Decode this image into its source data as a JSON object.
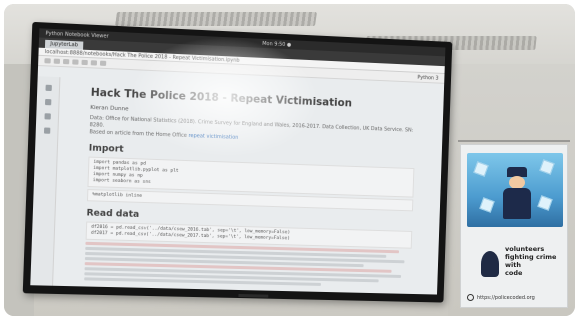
{
  "photo": {
    "description_tag": "photo of a wall-mounted TV showing a Jupyter notebook, with a poster at right"
  },
  "screen": {
    "system_bar": {
      "left": "Python Notebook Viewer",
      "center": "Mon 9:50 ●"
    },
    "tab": {
      "label": "JupyterLab"
    },
    "address": "localhost:8888/notebooks/Hack The Police 2018 - Repeat Victimisation.ipynb",
    "kernel": "Python 3",
    "notebook": {
      "title": "Hack The Police 2018 - Repeat Victimisation",
      "author": "Kieran Dunne",
      "line1": "Data: Office for National Statistics (2018). Crime Survey for England and Wales, 2016-2017. Data Collection, UK Data Service. SN: 8280.",
      "line2": "Based on article from the Home Office",
      "link_text": "repeat victimisation",
      "import_heading": "Import",
      "import_code": [
        "import pandas as pd",
        "import matplotlib.pyplot as plt",
        "import numpy as np",
        "import seaborn as sns"
      ],
      "magic_line": "%matplotlib inline",
      "read_heading": "Read data",
      "read_code": [
        "df2016 = pd.read_csv('../data/csew_2016.tab', sep='\\t', low_memory=False)",
        "df2017 = pd.read_csv('../data/csew_2017.tab', sep='\\t', low_memory=False)"
      ]
    }
  },
  "poster": {
    "line1": "volunteers",
    "line2": "fighting crime",
    "line3": "with",
    "line4": "code",
    "url": "https://policecoded.org"
  }
}
